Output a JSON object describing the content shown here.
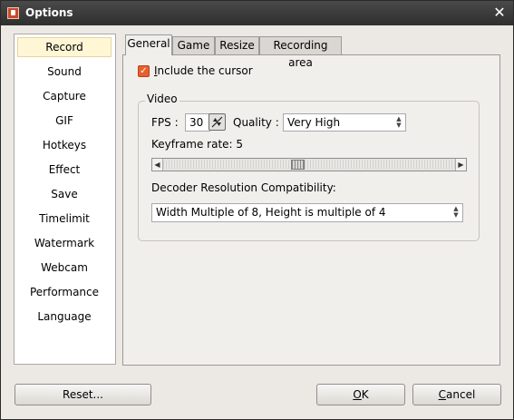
{
  "window": {
    "title": "Options",
    "close_label": "✕"
  },
  "sidebar": {
    "items": [
      {
        "label": "Record"
      },
      {
        "label": "Sound"
      },
      {
        "label": "Capture"
      },
      {
        "label": "GIF"
      },
      {
        "label": "Hotkeys"
      },
      {
        "label": "Effect"
      },
      {
        "label": "Save"
      },
      {
        "label": "Timelimit"
      },
      {
        "label": "Watermark"
      },
      {
        "label": "Webcam"
      },
      {
        "label": "Performance"
      },
      {
        "label": "Language"
      }
    ],
    "selected": "Record"
  },
  "tabs": [
    {
      "label": "General"
    },
    {
      "label": "Game"
    },
    {
      "label": "Resize"
    },
    {
      "label": "Recording area"
    }
  ],
  "general": {
    "include_cursor": {
      "checked": true,
      "label_first": "I",
      "label_rest": "nclude the cursor"
    },
    "video_group": {
      "title": "Video",
      "fps_label": "FPS :",
      "fps_value": "30",
      "quality_label": "Quality :",
      "quality_value": "Very High",
      "keyframe_label": "Keyframe rate: 5",
      "keyframe_fraction": 0.46,
      "decoder_label": "Decoder Resolution Compatibility:",
      "decoder_value": "Width Multiple of 8, Height is multiple of 4"
    }
  },
  "buttons": {
    "reset": "Reset...",
    "ok_first": "O",
    "ok_rest": "K",
    "cancel_first": "C",
    "cancel_rest": "ancel"
  },
  "colors": {
    "checkbox": "#e8602c",
    "selected_item_bg": "#fff6d6",
    "titlebar": "#3a3a3a"
  }
}
